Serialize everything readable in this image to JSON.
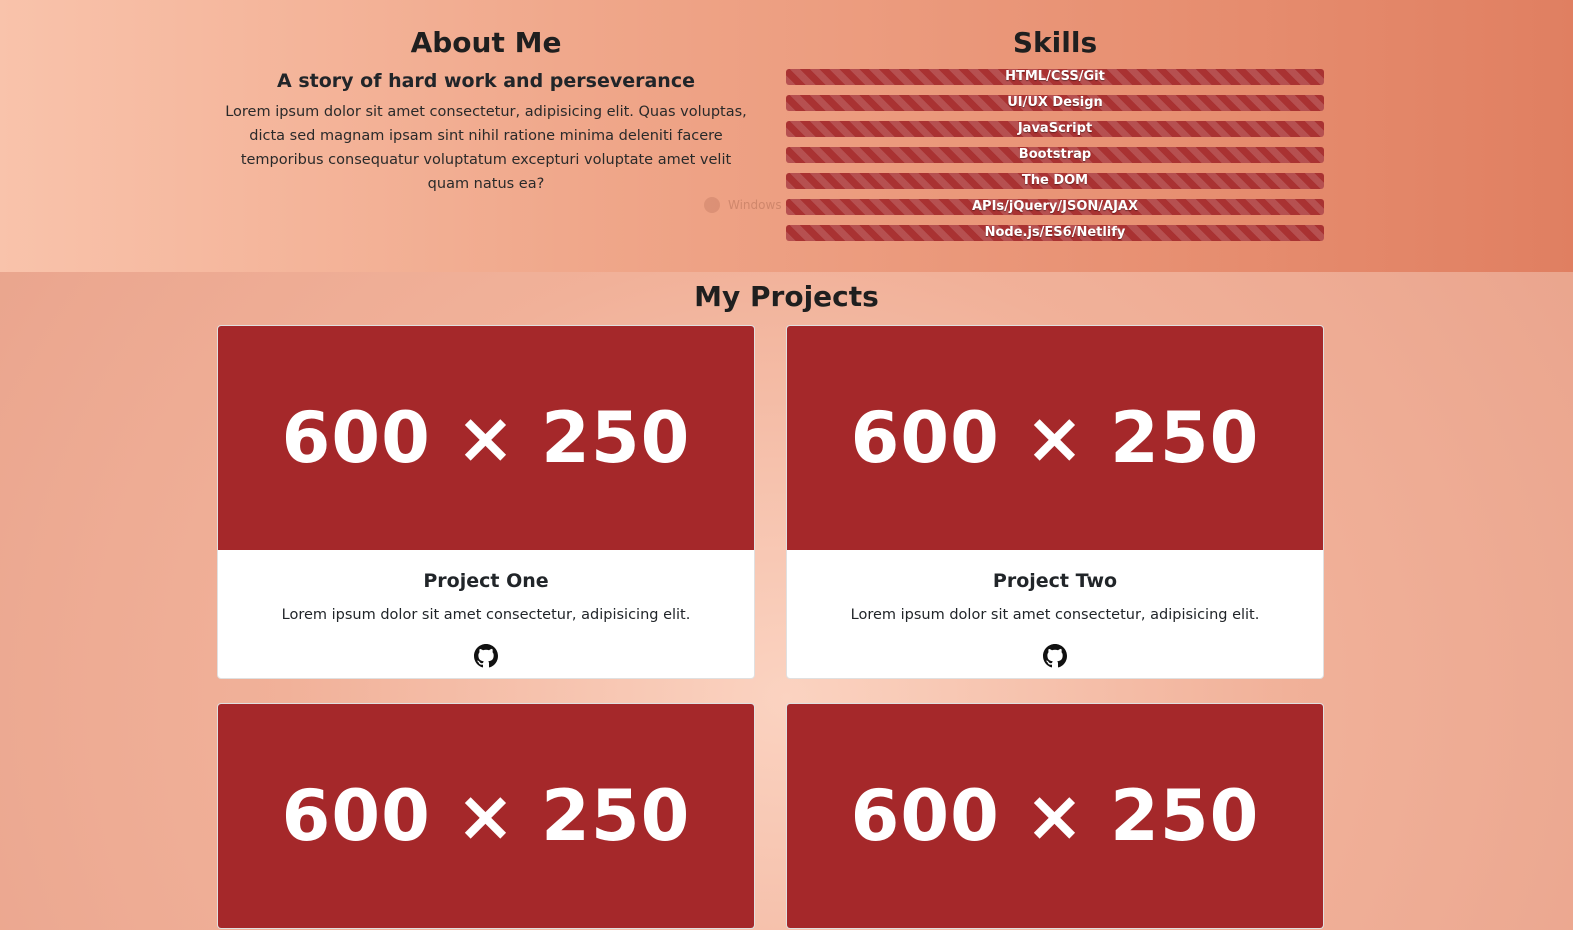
{
  "about": {
    "heading": "About Me",
    "subheading": "A story of hard work and perseverance",
    "text": "Lorem ipsum dolor sit amet consectetur, adipisicing elit. Quas voluptas, dicta sed magnam ipsam sint nihil ratione minima deleniti facere temporibus consequatur voluptatum excepturi voluptate amet velit quam natus ea?"
  },
  "skills": {
    "heading": "Skills",
    "items": [
      {
        "label": "HTML/CSS/Git"
      },
      {
        "label": "UI/UX Design"
      },
      {
        "label": "JavaScript"
      },
      {
        "label": "Bootstrap"
      },
      {
        "label": "The DOM"
      },
      {
        "label": "APIs/jQuery/JSON/AJAX"
      },
      {
        "label": "Node.js/ES6/Netlify"
      }
    ],
    "bar_color": "#a93232"
  },
  "watermark": {
    "text": "Windows"
  },
  "projects": {
    "heading": "My Projects",
    "placeholder_color": "#a5282a",
    "cards": [
      {
        "image_text": "600 × 250",
        "title": "Project One",
        "text": "Lorem ipsum dolor sit amet consectetur, adipisicing elit.",
        "icon": "github-icon"
      },
      {
        "image_text": "600 × 250",
        "title": "Project Two",
        "text": "Lorem ipsum dolor sit amet consectetur, adipisicing elit.",
        "icon": "github-icon"
      },
      {
        "image_text": "600 × 250"
      },
      {
        "image_text": "600 × 250"
      }
    ]
  }
}
